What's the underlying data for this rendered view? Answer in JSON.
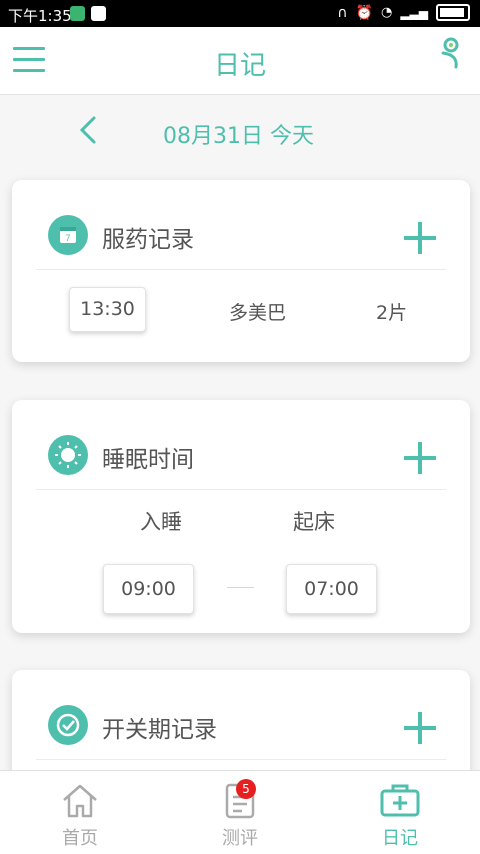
{
  "status_bar": {
    "time": "下午1:35"
  },
  "header": {
    "title": "日记"
  },
  "date_nav": {
    "date_text": "08月31日 今天"
  },
  "medication_card": {
    "title": "服药记录",
    "entry": {
      "time": "13:30",
      "drug": "多美巴",
      "dose": "2片"
    }
  },
  "sleep_card": {
    "title": "睡眠时间",
    "sleep_label": "入睡",
    "wake_label": "起床",
    "sleep_time": "09:00",
    "wake_time": "07:00"
  },
  "onoff_card": {
    "title": "开关期记录"
  },
  "tabs": [
    {
      "label": "首页",
      "icon": "home-icon"
    },
    {
      "label": "测评",
      "icon": "document-icon",
      "badge": "5"
    },
    {
      "label": "日记",
      "icon": "medical-kit-icon"
    }
  ],
  "colors": {
    "accent": "#4fbfad",
    "badge": "#e62020"
  }
}
